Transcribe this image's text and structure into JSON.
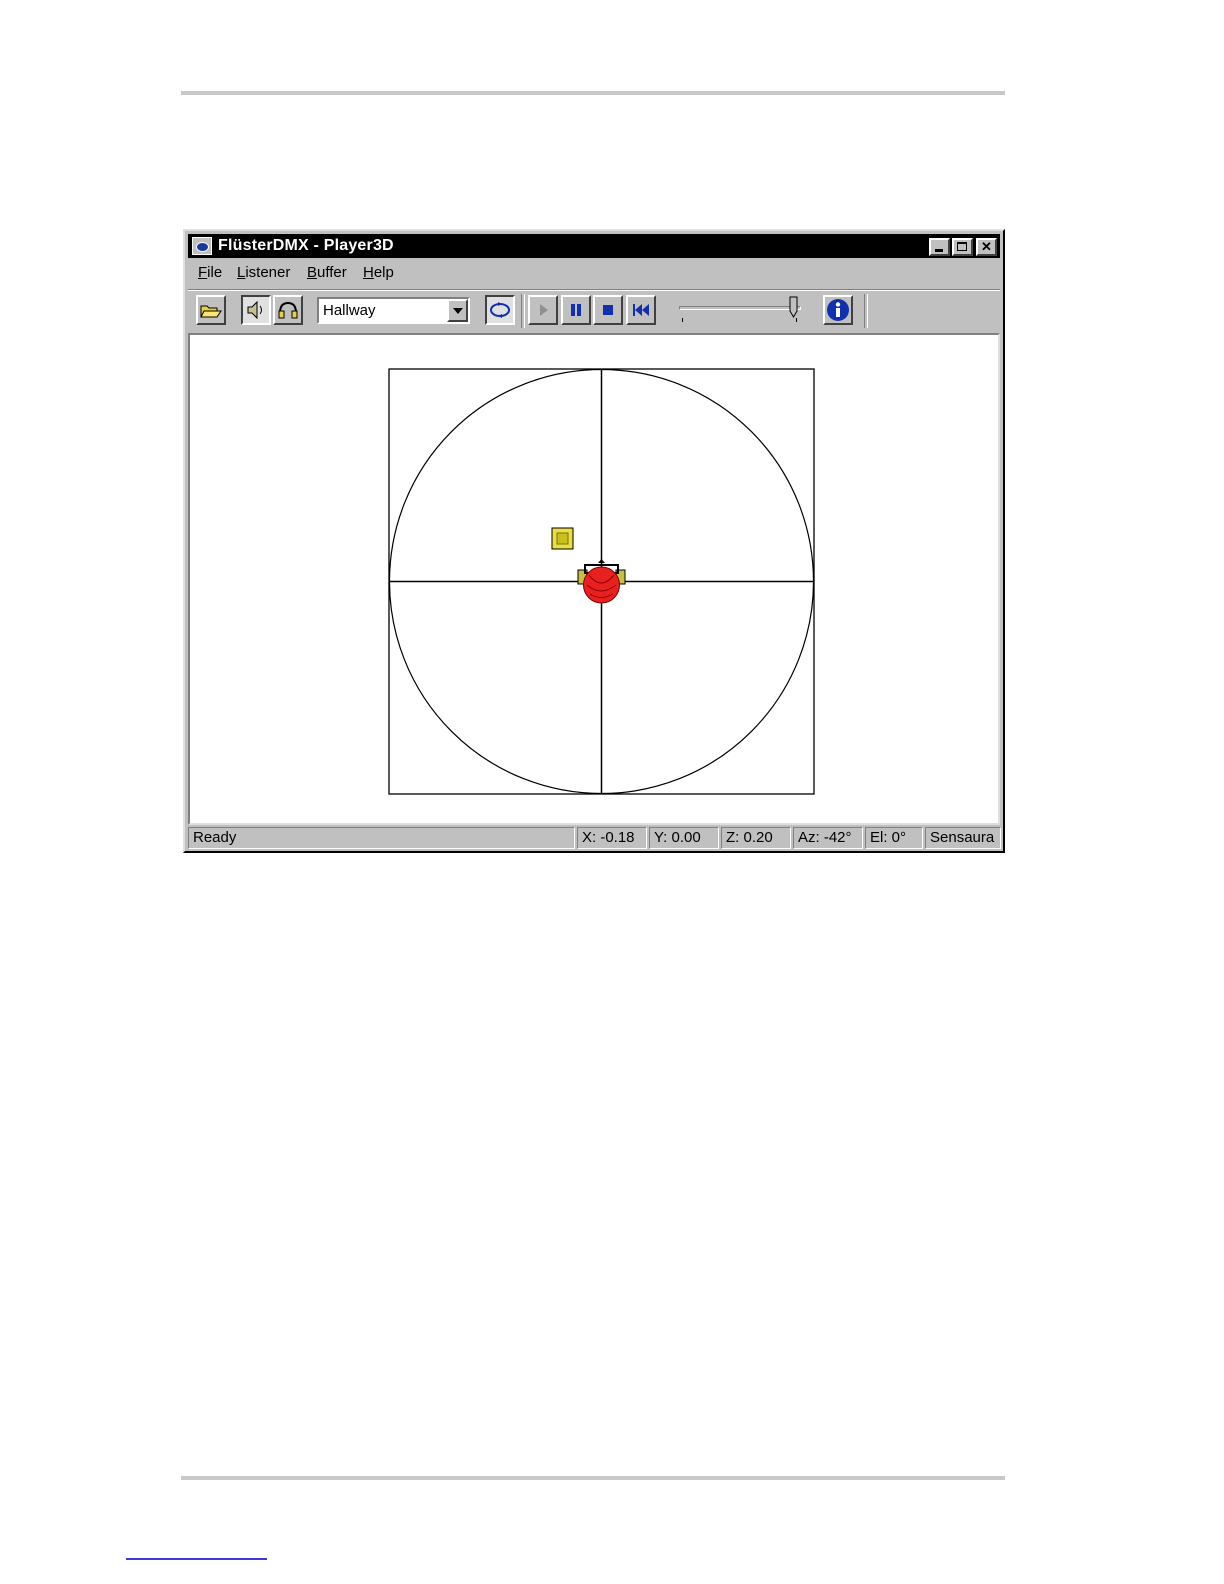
{
  "window": {
    "title": "FlüsterDMX - Player3D"
  },
  "menu": {
    "file": "File",
    "listener": "Listener",
    "buffer": "Buffer",
    "help": "Help"
  },
  "toolbar": {
    "environment_value": "Hallway"
  },
  "scene": {
    "source_marker_color": "#e8e040",
    "listener_color": "#e82020"
  },
  "status": {
    "message": "Ready",
    "x": "X: -0.18",
    "y": "Y:  0.00",
    "z": "Z:  0.20",
    "az": "Az:  -42°",
    "el": "El:   0°",
    "engine": "Sensaura"
  },
  "icons": [
    "open-folder-icon",
    "speaker-icon",
    "headphones-icon",
    "loop-icon",
    "play-icon",
    "pause-icon",
    "stop-icon",
    "rewind-icon",
    "info-icon"
  ]
}
